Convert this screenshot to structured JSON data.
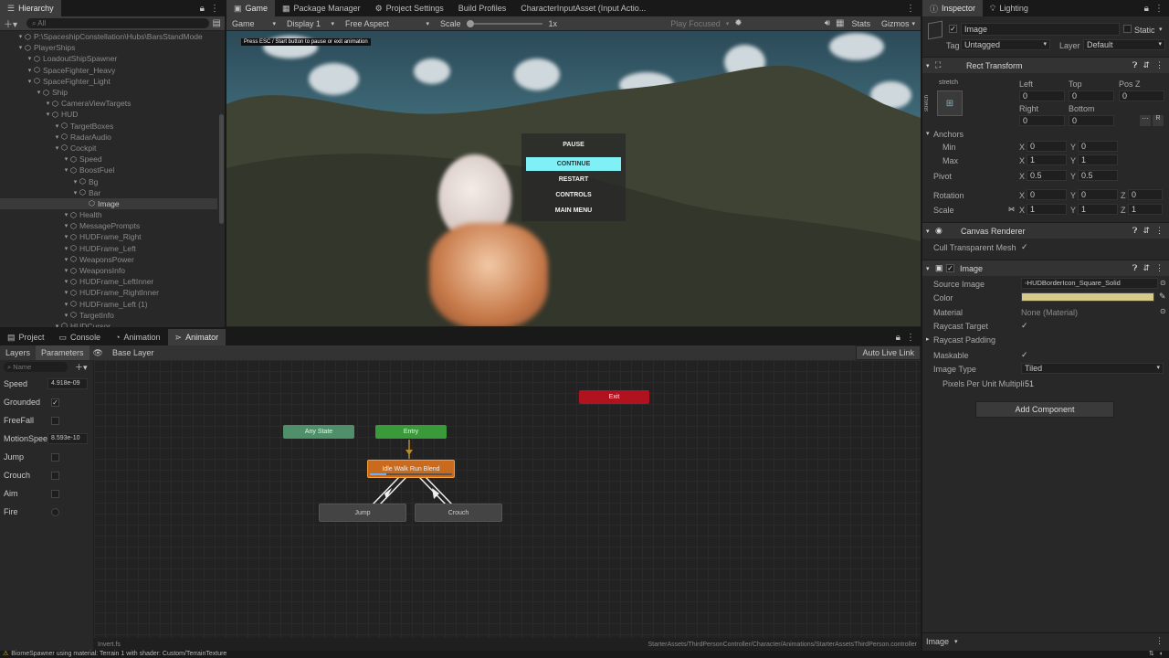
{
  "hierarchy": {
    "tab": "Hierarchy",
    "search_placeholder": "All",
    "rows": [
      {
        "label": "P:\\SpaceshipConstellation\\Hubs\\BarsStandMode",
        "depth": 0,
        "dim": true
      },
      {
        "label": "PlayerShips",
        "depth": 0,
        "dim": true
      },
      {
        "label": "LoadoutShipSpawner",
        "depth": 1,
        "dim": true
      },
      {
        "label": "SpaceFighter_Heavy",
        "depth": 1,
        "dim": true
      },
      {
        "label": "SpaceFighter_Light",
        "depth": 1,
        "dim": true
      },
      {
        "label": "Ship",
        "depth": 2,
        "dim": true
      },
      {
        "label": "CameraViewTargets",
        "depth": 3,
        "dim": true
      },
      {
        "label": "HUD",
        "depth": 3,
        "dim": true
      },
      {
        "label": "TargetBoxes",
        "depth": 4,
        "dim": true
      },
      {
        "label": "RadarAudio",
        "depth": 4,
        "dim": true
      },
      {
        "label": "Cockpit",
        "depth": 4,
        "dim": true
      },
      {
        "label": "Speed",
        "depth": 5,
        "dim": true
      },
      {
        "label": "BoostFuel",
        "depth": 5,
        "dim": true
      },
      {
        "label": "Bg",
        "depth": 6,
        "dim": true
      },
      {
        "label": "Bar",
        "depth": 6,
        "dim": true
      },
      {
        "label": "Image",
        "depth": 7,
        "dim": false,
        "selected": true
      },
      {
        "label": "Health",
        "depth": 5,
        "dim": true
      },
      {
        "label": "MessagePrompts",
        "depth": 5,
        "dim": true
      },
      {
        "label": "HUDFrame_Right",
        "depth": 5,
        "dim": true
      },
      {
        "label": "HUDFrame_Left",
        "depth": 5,
        "dim": true
      },
      {
        "label": "WeaponsPower",
        "depth": 5,
        "dim": true
      },
      {
        "label": "WeaponsInfo",
        "depth": 5,
        "dim": true
      },
      {
        "label": "HUDFrame_LeftInner",
        "depth": 5,
        "dim": true
      },
      {
        "label": "HUDFrame_RightInner",
        "depth": 5,
        "dim": true
      },
      {
        "label": "HUDFrame_Left (1)",
        "depth": 5,
        "dim": true
      },
      {
        "label": "TargetInfo",
        "depth": 5,
        "dim": true
      },
      {
        "label": "HUDCursor",
        "depth": 4,
        "dim": true
      }
    ]
  },
  "center_tabs": [
    {
      "label": "Game",
      "icon": "gamepad-icon",
      "active": true
    },
    {
      "label": "Package Manager",
      "icon": "package-icon",
      "active": false
    },
    {
      "label": "Project Settings",
      "icon": "gear-icon",
      "active": false
    },
    {
      "label": "Build Profiles",
      "icon": "",
      "active": false
    },
    {
      "label": "CharacterInputAsset (Input Actio...",
      "icon": "",
      "active": false
    }
  ],
  "game_toolbar": {
    "mode": "Game",
    "display": "Display 1",
    "aspect": "Free Aspect",
    "scale_label": "Scale",
    "scale_value": "1x",
    "play_focused": "Play Focused",
    "stats": "Stats",
    "gizmos": "Gizmos"
  },
  "game_view": {
    "hint": "Press ESC / Start button to pause or exit animation",
    "pause_title": "PAUSE",
    "menu": [
      "CONTINUE",
      "RESTART",
      "CONTROLS",
      "MAIN MENU"
    ]
  },
  "inspector": {
    "tabs": [
      "Inspector",
      "Lighting"
    ],
    "object_name": "Image",
    "static_label": "Static",
    "tag_label": "Tag",
    "tag_value": "Untagged",
    "layer_label": "Layer",
    "layer_value": "Default",
    "rect_transform": {
      "title": "Rect Transform",
      "stretch": "stretch",
      "col_labels": [
        "Left",
        "Top",
        "Pos Z"
      ],
      "row1": [
        "0",
        "0",
        "0"
      ],
      "col_labels2": [
        "Right",
        "Bottom"
      ],
      "row2": [
        "0",
        "0"
      ],
      "anchors": "Anchors",
      "min": "Min",
      "max": "Max",
      "pivot": "Pivot",
      "rotation": "Rotation",
      "scale": "Scale",
      "min_x": "0",
      "min_y": "0",
      "max_x": "1",
      "max_y": "1",
      "pivot_x": "0.5",
      "pivot_y": "0.5",
      "rot_x": "0",
      "rot_y": "0",
      "rot_z": "0",
      "scale_x": "1",
      "scale_y": "1",
      "scale_z": "1"
    },
    "canvas_renderer": {
      "title": "Canvas Renderer",
      "cull_label": "Cull Transparent Mesh"
    },
    "image": {
      "title": "Image",
      "source_label": "Source Image",
      "source_value": "HUDBorderIcon_Square_Solid",
      "color_label": "Color",
      "color_value": "#d6c98a",
      "material_label": "Material",
      "material_value": "None (Material)",
      "raycast_target": "Raycast Target",
      "raycast_padding": "Raycast Padding",
      "maskable": "Maskable",
      "image_type_label": "Image Type",
      "image_type_value": "Tiled",
      "ppu_label": "Pixels Per Unit Multipli",
      "ppu_value": "51"
    },
    "add_component": "Add Component",
    "footer_label": "Image"
  },
  "bottom_tabs": [
    {
      "label": "Project",
      "icon": "folder-icon",
      "active": false
    },
    {
      "label": "Console",
      "icon": "console-icon",
      "active": false
    },
    {
      "label": "Animation",
      "icon": "animation-icon",
      "active": false
    },
    {
      "label": "Animator",
      "icon": "animator-icon",
      "active": true
    }
  ],
  "animator": {
    "layers_tab": "Layers",
    "params_tab": "Parameters",
    "base_layer": "Base Layer",
    "search_placeholder": "Name",
    "auto_live_link": "Auto Live Link",
    "params": [
      {
        "name": "Speed",
        "type": "float",
        "value": "4.918e-09"
      },
      {
        "name": "Grounded",
        "type": "bool",
        "value": true
      },
      {
        "name": "FreeFall",
        "type": "bool",
        "value": false
      },
      {
        "name": "MotionSpeed",
        "type": "float",
        "value": "8.593e-10"
      },
      {
        "name": "Jump",
        "type": "bool",
        "value": false
      },
      {
        "name": "Crouch",
        "type": "bool",
        "value": false
      },
      {
        "name": "Aim",
        "type": "bool",
        "value": false
      },
      {
        "name": "Fire",
        "type": "trigger",
        "value": false
      }
    ],
    "nodes": {
      "exit": "Exit",
      "any": "Any State",
      "entry": "Entry",
      "blend": "Idle Walk Run Blend",
      "jump": "Jump",
      "crouch": "Crouch"
    },
    "footer_left": "Invert.fs",
    "footer_right": "StarterAssets/ThirdPersonController/Character/Animations/StarterAssetsThirdPerson.controller"
  },
  "status_bar": "BiomeSpawner using material: Terrain 1 with shader: Custom/TerrainTexture",
  "colors": {
    "exit": "#b0121f",
    "any": "#4f8f6a",
    "entry": "#3a9a3a",
    "blend": "#c96a1c",
    "continue_bg": "#7ff0f5"
  }
}
